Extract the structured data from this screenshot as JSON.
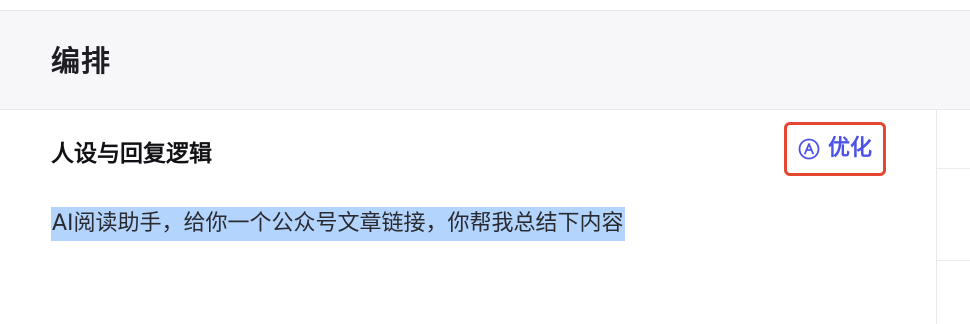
{
  "section": {
    "title": "编排"
  },
  "persona": {
    "label": "人设与回复逻辑",
    "optimize_label": "优化",
    "prompt": "AI阅读助手，给你一个公众号文章链接，你帮我总结下内容"
  },
  "colors": {
    "accent": "#4d53e8",
    "highlight_border": "#e5462f",
    "selection": "#b3d4fc"
  },
  "icons": {
    "optimize": "circled-a-icon"
  }
}
